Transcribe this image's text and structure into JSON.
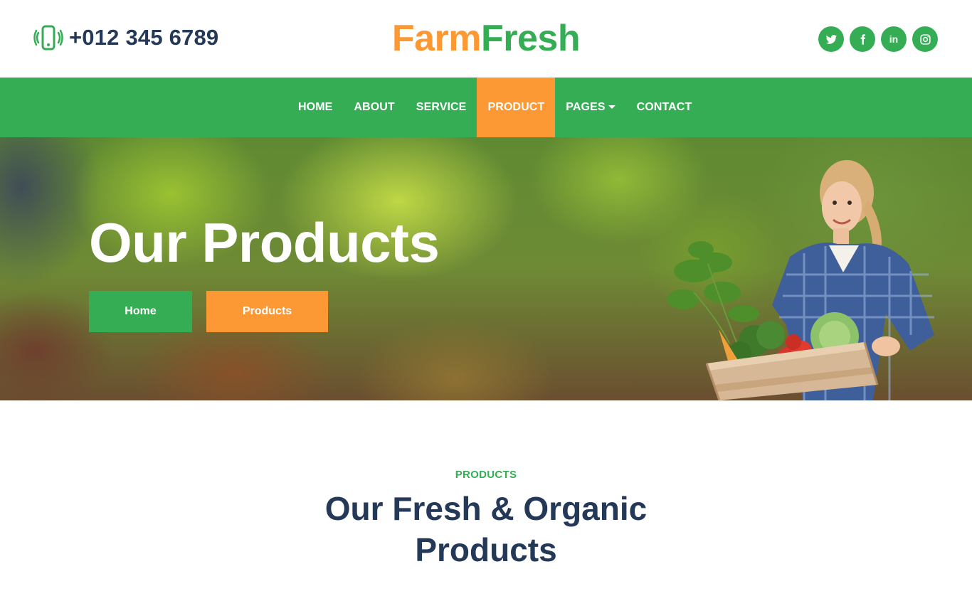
{
  "header": {
    "phone_icon": "mobile-vibrate-icon",
    "phone": "+012 345 6789",
    "logo_part1": "Farm",
    "logo_part2": "Fresh",
    "socials": [
      {
        "icon": "twitter-icon"
      },
      {
        "icon": "facebook-icon"
      },
      {
        "icon": "linkedin-icon",
        "label": "in"
      },
      {
        "icon": "instagram-icon"
      }
    ]
  },
  "nav": {
    "items": [
      {
        "label": "HOME"
      },
      {
        "label": "ABOUT"
      },
      {
        "label": "SERVICE"
      },
      {
        "label": "PRODUCT",
        "active": true
      },
      {
        "label": "PAGES",
        "dropdown": true
      },
      {
        "label": "CONTACT"
      }
    ]
  },
  "hero": {
    "title": "Our Products",
    "breadcrumb_home": "Home",
    "breadcrumb_current": "Products"
  },
  "section": {
    "subtitle": "PRODUCTS",
    "title": "Our Fresh & Organic Products"
  },
  "colors": {
    "primary_green": "#35ad55",
    "accent_orange": "#fd9935",
    "dark_text": "#243858"
  }
}
